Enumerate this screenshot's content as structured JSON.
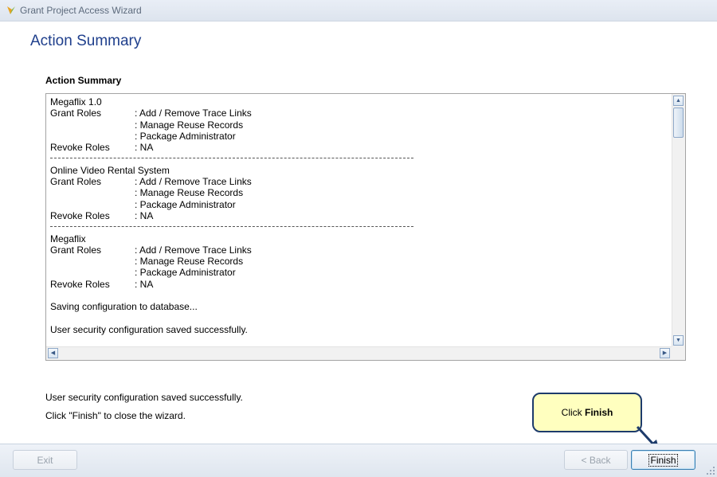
{
  "window": {
    "title": "Grant Project Access Wizard"
  },
  "header": {
    "title": "Action Summary"
  },
  "summary": {
    "label": "Action Summary",
    "blocks": [
      {
        "project": "Megaflix 1.0",
        "grant_label": "Grant Roles",
        "grant_roles": [
          ": Add / Remove Trace Links",
          ": Manage Reuse Records",
          ": Package Administrator"
        ],
        "revoke_label": "Revoke Roles",
        "revoke_value": ": NA"
      },
      {
        "project": "Online Video Rental System",
        "grant_label": "Grant Roles",
        "grant_roles": [
          ": Add / Remove Trace Links",
          ": Manage Reuse Records",
          ": Package Administrator"
        ],
        "revoke_label": "Revoke Roles",
        "revoke_value": ": NA"
      },
      {
        "project": "Megaflix",
        "grant_label": "Grant Roles",
        "grant_roles": [
          ": Add / Remove Trace Links",
          ": Manage Reuse Records",
          ": Package Administrator"
        ],
        "revoke_label": "Revoke Roles",
        "revoke_value": ": NA"
      }
    ],
    "saving": "Saving configuration to database...",
    "saved": "User security configuration saved successfully."
  },
  "footer": {
    "message1": "User security configuration saved successfully.",
    "message2": "Click \"Finish\" to close the wizard."
  },
  "buttons": {
    "exit": "Exit",
    "back": "< Back",
    "finish": "Finish"
  },
  "callout": {
    "prefix": "Click",
    "bold": "Finish"
  },
  "colors": {
    "title": "#1f3f8c",
    "callout_bg": "#ffffbf",
    "callout_border": "#1d3b6b"
  }
}
